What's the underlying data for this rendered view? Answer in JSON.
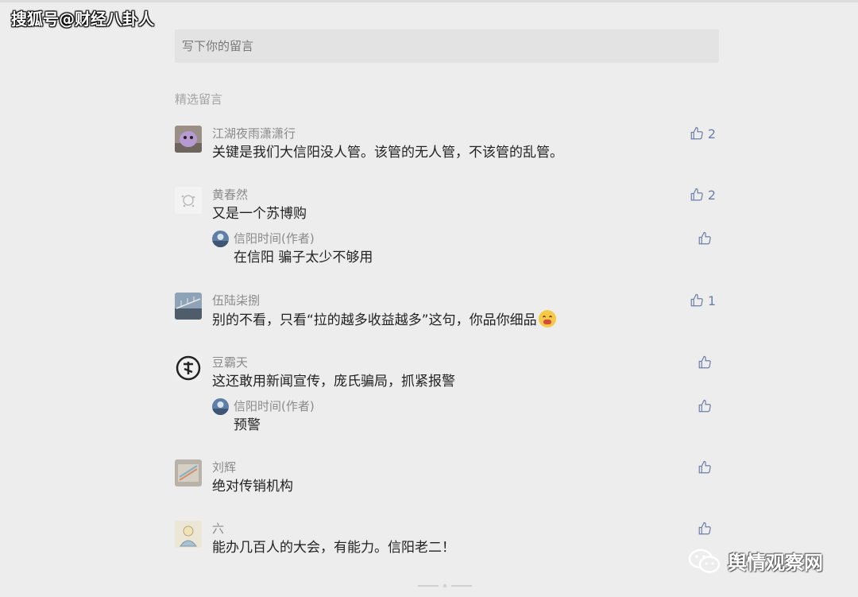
{
  "watermark_top": "搜狐号@财经八卦人",
  "input": {
    "placeholder": "写下你的留言"
  },
  "section_title": "精选留言",
  "comments": [
    {
      "name": "江湖夜雨潇潇行",
      "text": "关键是我们大信阳没人管。该管的无人管，不该管的乱管。",
      "likes": "2"
    },
    {
      "name": "黄春然",
      "text": "又是一个苏博购",
      "likes": "2",
      "reply": {
        "name": "信阳时间(作者)",
        "text": "在信阳 骗子太少不够用",
        "likes": ""
      }
    },
    {
      "name": "伍陆柒捌",
      "text": "别的不看，只看“拉的越多收益越多”这句，你品你细品",
      "likes": "1"
    },
    {
      "name": "豆霸天",
      "text": "这还敢用新闻宣传，庞氏骗局，抓紧报警",
      "likes": "",
      "reply": {
        "name": "信阳时间(作者)",
        "text": "预警",
        "likes": ""
      }
    },
    {
      "name": "刘辉",
      "text": "绝对传销机构",
      "likes": ""
    },
    {
      "name": "六",
      "text": "能办几百人的大会，有能力。信阳老二！",
      "likes": ""
    }
  ],
  "watermark_bottom": "舆情观察网",
  "icons": {
    "like": "thumbs-up-icon",
    "emoji": "grimace-emoji-icon",
    "wechat": "wechat-logo-icon"
  },
  "colors": {
    "background": "#ededed",
    "link_blue": "#6b7fa8",
    "muted": "#8a8a8a"
  }
}
